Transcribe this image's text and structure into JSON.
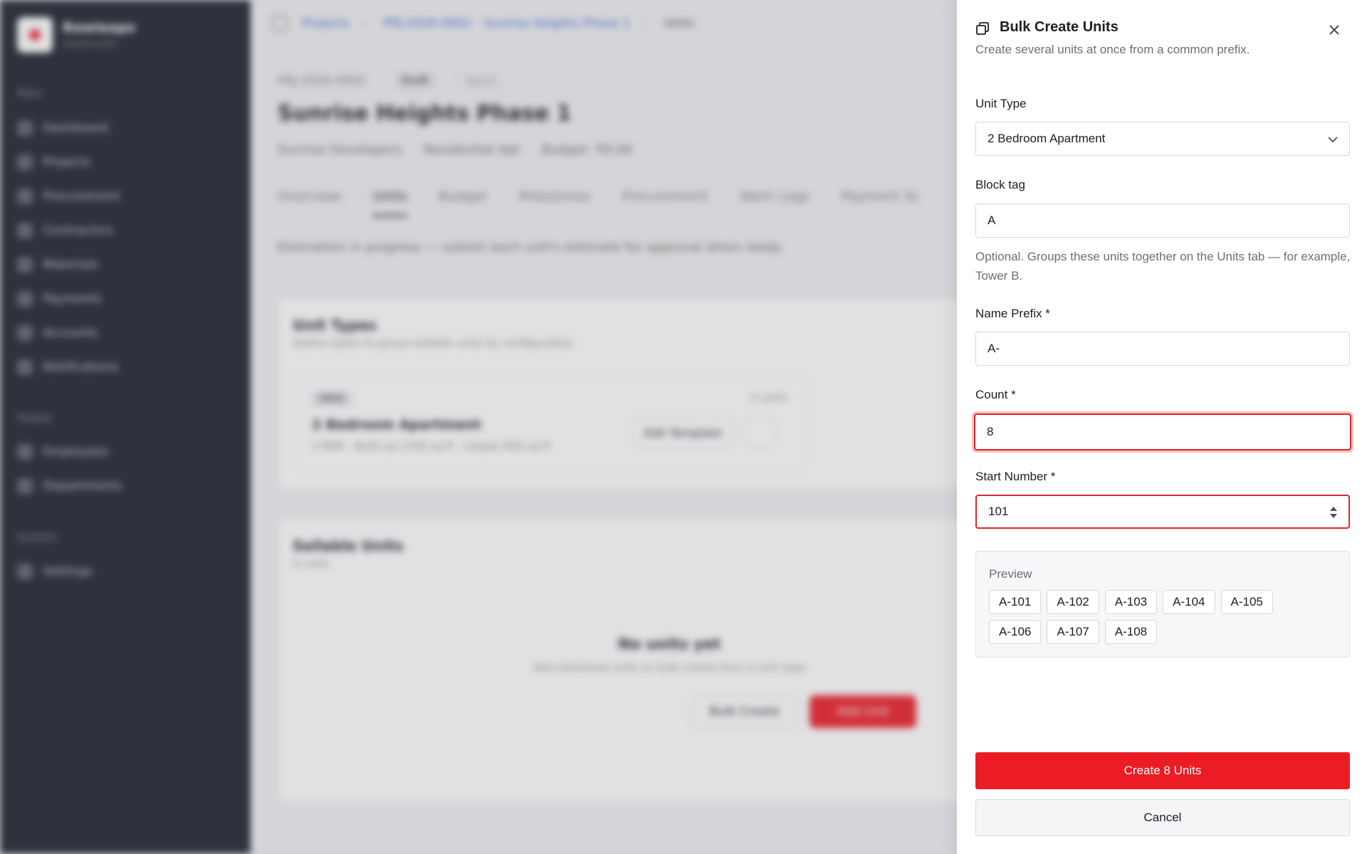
{
  "background": {
    "sidebar": {
      "brand_name": "Rowleaps",
      "brand_sub": "Construction",
      "section_main": "Main",
      "main_items": [
        "Dashboard",
        "Projects",
        "Procurement",
        "Contractors",
        "Materials",
        "Payments",
        "Accounts",
        "Notifications"
      ],
      "section_people": "People",
      "people_items": [
        "Employees",
        "Departments"
      ],
      "section_system": "System",
      "system_items": [
        "Settings"
      ]
    },
    "breadcrumb": {
      "projects": "Projects",
      "project": "PRJ-2026-0002 · Sunrise Heights Phase 1",
      "current": "Units"
    },
    "project": {
      "code": "PRJ-2026-0002",
      "status": "Draft",
      "stage": "Quick",
      "title": "Sunrise Heights Phase 1",
      "client": "Sunrise Developers",
      "type": "Residential Apt",
      "budget": "Budget: ₹0.00"
    },
    "tabs": [
      "Overview",
      "Units",
      "Budget",
      "Milestones",
      "Procurement",
      "Work Logs",
      "Payment Sc"
    ],
    "notice": "Estimation in progress — submit each unit's estimate for approval when ready.",
    "unit_types": {
      "title": "Unit Types",
      "subtitle": "Define types to group sellable units by configuration",
      "tag": "2BHK",
      "name": "2 Bedroom Apartment",
      "meta": "2 BHK · Built-up 1100 sq ft · Carpet 900 sq ft",
      "count": "0 units",
      "edit_button": "Edit Template"
    },
    "sellable": {
      "title": "Sellable Units",
      "subtitle": "0 units",
      "empty_title": "No units yet",
      "empty_sub": "Add individual units or bulk create from a unit type",
      "bulk_button": "Bulk Create",
      "add_button": "Add Unit"
    }
  },
  "drawer": {
    "title": "Bulk Create Units",
    "subtitle": "Create several units at once from a common prefix.",
    "unit_type": {
      "label": "Unit Type",
      "value": "2 Bedroom Apartment"
    },
    "block_tag": {
      "label": "Block tag",
      "value": "A",
      "help": "Optional. Groups these units together on the Units tab — for example, Tower B."
    },
    "name_prefix": {
      "label": "Name Prefix *",
      "value": "A-"
    },
    "count": {
      "label": "Count *",
      "value": "8"
    },
    "start_number": {
      "label": "Start Number *",
      "value": "101"
    },
    "preview": {
      "label": "Preview",
      "items": [
        "A-101",
        "A-102",
        "A-103",
        "A-104",
        "A-105",
        "A-106",
        "A-107",
        "A-108"
      ]
    },
    "create_button": "Create 8 Units",
    "cancel_button": "Cancel"
  },
  "colors": {
    "accent": "#eb1c24",
    "error": "#d9272f",
    "sidebar_bg": "#1b1f2a"
  }
}
